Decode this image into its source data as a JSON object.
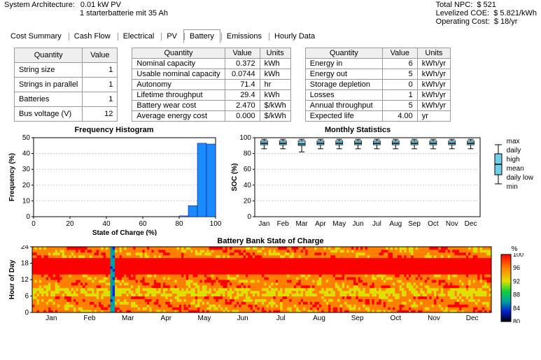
{
  "header": {
    "arch_label": "System Architecture:",
    "pv": "0.01 kW PV",
    "batt_desc": "1 starterbatterie mit 35 Ah",
    "npc_label": "Total NPC:",
    "npc": "$ 521",
    "coe_label": "Levelized COE:",
    "coe": "$ 5.821/kWh",
    "opcost_label": "Operating Cost:",
    "opcost": "$ 18/yr"
  },
  "tabs": [
    "Cost Summary",
    "Cash Flow",
    "Electrical",
    "PV",
    "Battery",
    "Emissions",
    "Hourly Data"
  ],
  "active_tab": 4,
  "table1": {
    "headers": [
      "Quantity",
      "Value"
    ],
    "rows": [
      {
        "q": "String size",
        "v": "1"
      },
      {
        "q": "Strings in parallel",
        "v": "1"
      },
      {
        "q": "Batteries",
        "v": "1"
      },
      {
        "q": "Bus voltage (V)",
        "v": "12"
      }
    ]
  },
  "table2": {
    "headers": [
      "Quantity",
      "Value",
      "Units"
    ],
    "rows": [
      {
        "q": "Nominal capacity",
        "v": "0.372",
        "u": "kWh"
      },
      {
        "q": "Usable nominal capacity",
        "v": "0.0744",
        "u": "kWh"
      },
      {
        "q": "Autonomy",
        "v": "71.4",
        "u": "hr"
      },
      {
        "q": "Lifetime throughput",
        "v": "29.4",
        "u": "kWh"
      },
      {
        "q": "Battery wear cost",
        "v": "2.470",
        "u": "$/kWh"
      },
      {
        "q": "Average energy cost",
        "v": "0.000",
        "u": "$/kWh"
      }
    ]
  },
  "table3": {
    "headers": [
      "Quantity",
      "Value",
      "Units"
    ],
    "rows": [
      {
        "q": "Energy in",
        "v": "6",
        "u": "kWh/yr"
      },
      {
        "q": "Energy out",
        "v": "5",
        "u": "kWh/yr"
      },
      {
        "q": "Storage depletion",
        "v": "0",
        "u": "kWh/yr"
      },
      {
        "q": "Losses",
        "v": "1",
        "u": "kWh/yr"
      },
      {
        "q": "Annual throughput",
        "v": "5",
        "u": "kWh/yr"
      },
      {
        "q": "Expected life",
        "v": "4.00",
        "u": "yr"
      }
    ]
  },
  "chart_data": [
    {
      "type": "bar",
      "title": "Frequency Histogram",
      "xlabel": "State of Charge (%)",
      "ylabel": "Frequency (%)",
      "xlim": [
        0,
        100
      ],
      "ylim": [
        0,
        50
      ],
      "xticks": [
        0,
        20,
        40,
        60,
        80,
        100
      ],
      "yticks": [
        0,
        10,
        20,
        30,
        40,
        50
      ],
      "bin_width": 5,
      "categories": [
        82.5,
        87.5,
        92.5,
        97.5
      ],
      "values": [
        0.5,
        7,
        46.5,
        46
      ]
    },
    {
      "type": "box",
      "title": "Monthly Statistics",
      "xlabel": "",
      "ylabel": "SOC (%)",
      "ylim": [
        0,
        100
      ],
      "yticks": [
        0,
        20,
        40,
        60,
        80,
        100
      ],
      "categories": [
        "Jan",
        "Feb",
        "Mar",
        "Apr",
        "May",
        "Jun",
        "Jul",
        "Aug",
        "Sep",
        "Oct",
        "Nov",
        "Dec"
      ],
      "series": [
        {
          "min": 86,
          "low": 91,
          "mean": 93,
          "high": 96,
          "max": 98
        },
        {
          "min": 86,
          "low": 91,
          "mean": 93,
          "high": 96,
          "max": 98
        },
        {
          "min": 82,
          "low": 90,
          "mean": 92,
          "high": 96,
          "max": 98
        },
        {
          "min": 86,
          "low": 91,
          "mean": 93,
          "high": 96,
          "max": 98
        },
        {
          "min": 86,
          "low": 91,
          "mean": 93,
          "high": 96,
          "max": 98
        },
        {
          "min": 86,
          "low": 91,
          "mean": 93,
          "high": 96,
          "max": 98
        },
        {
          "min": 86,
          "low": 91,
          "mean": 93,
          "high": 96,
          "max": 98
        },
        {
          "min": 86,
          "low": 91,
          "mean": 93,
          "high": 96,
          "max": 98
        },
        {
          "min": 86,
          "low": 91,
          "mean": 93,
          "high": 96,
          "max": 98
        },
        {
          "min": 86,
          "low": 91,
          "mean": 93,
          "high": 96,
          "max": 98
        },
        {
          "min": 86,
          "low": 91,
          "mean": 93,
          "high": 96,
          "max": 98
        },
        {
          "min": 86,
          "low": 91,
          "mean": 93,
          "high": 96,
          "max": 98
        }
      ],
      "legend": [
        "max",
        "daily high",
        "mean",
        "daily low",
        "min"
      ]
    },
    {
      "type": "heatmap",
      "title": "Battery Bank State of Charge",
      "xlabel": "",
      "ylabel": "Hour of Day",
      "ylim": [
        0,
        24
      ],
      "yticks": [
        0,
        6,
        12,
        18,
        24
      ],
      "x_categories": [
        "Jan",
        "Feb",
        "Mar",
        "Apr",
        "May",
        "Jun",
        "Jul",
        "Aug",
        "Sep",
        "Oct",
        "Nov",
        "Dec"
      ],
      "color_scale": {
        "label": "%",
        "min": 80,
        "max": 100,
        "ticks": [
          80,
          84,
          88,
          92,
          96,
          100
        ],
        "colors": [
          "#000000",
          "#0020d0",
          "#00a0a0",
          "#10d040",
          "#e0e000",
          "#ff8000",
          "#ff0000"
        ]
      }
    }
  ],
  "legend_items": [
    "max",
    "daily high",
    "mean",
    "daily low",
    "min"
  ]
}
